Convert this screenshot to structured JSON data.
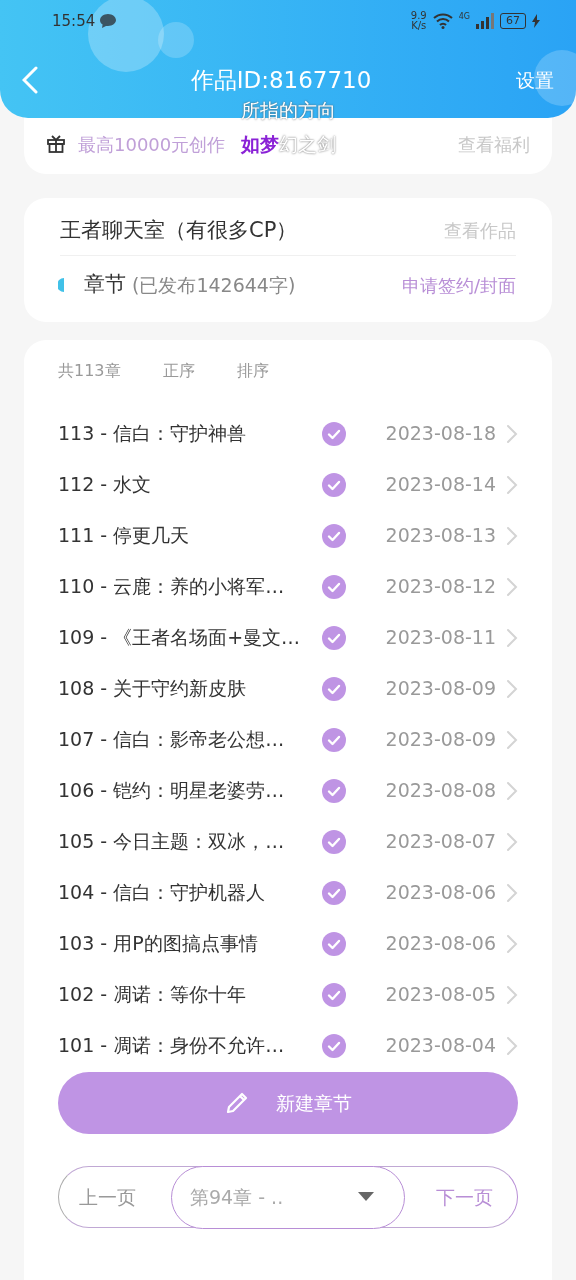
{
  "status_bar": {
    "time": "15:54",
    "net_speed_value": "9.9",
    "net_speed_unit": "K/s",
    "network": "4G",
    "battery": "67"
  },
  "header": {
    "title": "作品ID:8167710",
    "settings": "设置"
  },
  "lyrics_overlay": {
    "line_1": "所指的方向",
    "line_2_highlight": "如梦",
    "line_2_rest": "幻之剑"
  },
  "banner": {
    "text": "最高10000元创作",
    "link": "查看福利"
  },
  "work": {
    "title": "王者聊天室（有很多CP）",
    "view_link": "查看作品",
    "chapters_label": "章节",
    "published_count": "(已发布142644字)",
    "sign_link": "申请签约/封面"
  },
  "list_header": {
    "total": "共113章",
    "order": "正序",
    "sort": "排序"
  },
  "chapters": [
    {
      "title": "113 - 信白：守护神兽",
      "date": "2023-08-18",
      "published": true
    },
    {
      "title": "112 - 水文",
      "date": "2023-08-14",
      "published": true
    },
    {
      "title": "111 - 停更几天",
      "date": "2023-08-13",
      "published": true
    },
    {
      "title": "110 - 云鹿：养的小将军…",
      "date": "2023-08-12",
      "published": true
    },
    {
      "title": "109 - 《王者名场面+曼文…",
      "date": "2023-08-11",
      "published": true
    },
    {
      "title": "108 - 关于守约新皮肤",
      "date": "2023-08-09",
      "published": true
    },
    {
      "title": "107 - 信白：影帝老公想…",
      "date": "2023-08-09",
      "published": true
    },
    {
      "title": "106 - 铠约：明星老婆劳…",
      "date": "2023-08-08",
      "published": true
    },
    {
      "title": "105 - 今日主题：双冰，…",
      "date": "2023-08-07",
      "published": true
    },
    {
      "title": "104 - 信白：守护机器人",
      "date": "2023-08-06",
      "published": true
    },
    {
      "title": "103 - 用P的图搞点事情",
      "date": "2023-08-06",
      "published": true
    },
    {
      "title": "102 - 凋诺：等你十年",
      "date": "2023-08-05",
      "published": true
    },
    {
      "title": "101 - 凋诺：身份不允许…",
      "date": "2023-08-04",
      "published": true
    }
  ],
  "new_chapter_button": "新建章节",
  "pager": {
    "prev": "上一页",
    "select_value": "第94章 - ..",
    "next": "下一页"
  }
}
